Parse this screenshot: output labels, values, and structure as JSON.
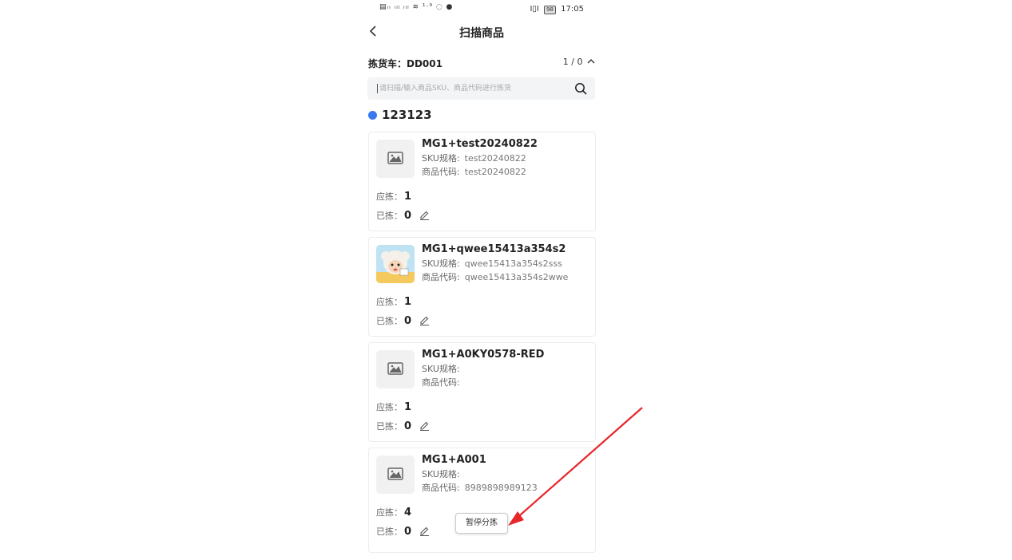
{
  "status_bar": {
    "left_icons": "▤ᵢᵢ ᵢₗₗ ᵢₗₗ ≋ ¹·⁹ ◌ ●",
    "battery": "98",
    "vibrate": "I▯I",
    "time": "17:05"
  },
  "header": {
    "title": "扫描商品"
  },
  "cart": {
    "label": "拣货车：DD001",
    "counter": "1 / 0"
  },
  "search": {
    "placeholder": "请扫描/输入商品SKU、商品代码进行拣货"
  },
  "group": {
    "name": "123123"
  },
  "labels": {
    "sku": "SKU规格:",
    "code": "商品代码:",
    "should_pick": "应拣：",
    "picked": "已拣："
  },
  "products": [
    {
      "name": "MG1+test20240822",
      "sku": "test20240822",
      "code": "test20240822",
      "should_pick": "1",
      "picked": "0",
      "image": "placeholder"
    },
    {
      "name": "MG1+qwee15413a354s2",
      "sku": "qwee15413a354s2sss",
      "code": "qwee15413a354s2wwe",
      "should_pick": "1",
      "picked": "0",
      "image": "photo"
    },
    {
      "name": "MG1+A0KY0578-RED",
      "sku": "",
      "code": "",
      "should_pick": "1",
      "picked": "0",
      "image": "placeholder"
    },
    {
      "name": "MG1+A001",
      "sku": "",
      "code": "8989898989123",
      "should_pick": "4",
      "picked": "0",
      "image": "placeholder"
    }
  ],
  "pause_button": {
    "label": "暂停分拣"
  },
  "colors": {
    "accent": "#3a78f0",
    "annotation_arrow": "#e8262a"
  }
}
